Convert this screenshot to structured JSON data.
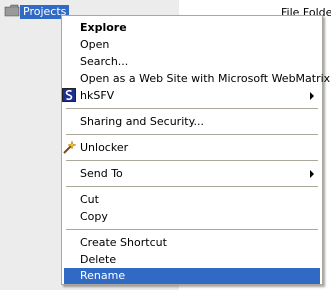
{
  "explorer": {
    "selected_folder": "Projects",
    "type_column_value": "File Folder"
  },
  "menu": {
    "items": [
      {
        "label": "Explore",
        "bold": true
      },
      {
        "label": "Open"
      },
      {
        "label": "Search..."
      },
      {
        "label": "Open as a Web Site with Microsoft WebMatrix"
      },
      {
        "label": "hkSFV",
        "icon": "hksfv-icon",
        "submenu": true
      },
      {
        "label": "Sharing and Security..."
      },
      {
        "label": "Unlocker",
        "icon": "unlocker-wand-icon"
      },
      {
        "label": "Send To",
        "submenu": true
      },
      {
        "label": "Cut"
      },
      {
        "label": "Copy"
      },
      {
        "label": "Create Shortcut"
      },
      {
        "label": "Delete"
      },
      {
        "label": "Rename",
        "selected": true
      }
    ]
  },
  "colors": {
    "selection": "#316ac5",
    "menu_border": "#aca899"
  }
}
